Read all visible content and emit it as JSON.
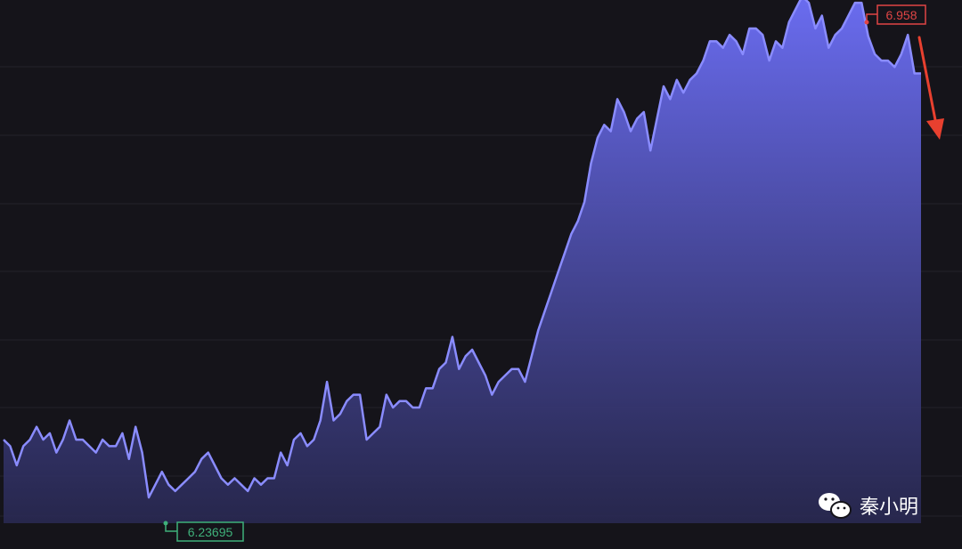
{
  "chart_data": {
    "type": "area",
    "title": "",
    "xlabel": "",
    "ylabel": "",
    "ylim": [
      6.2,
      6.97
    ],
    "grid": "horizontal",
    "legend": "none",
    "series": [
      {
        "values": [
          6.33,
          6.32,
          6.29,
          6.32,
          6.33,
          6.35,
          6.33,
          6.34,
          6.31,
          6.33,
          6.36,
          6.33,
          6.33,
          6.32,
          6.31,
          6.33,
          6.32,
          6.32,
          6.34,
          6.3,
          6.35,
          6.31,
          6.24,
          6.26,
          6.28,
          6.26,
          6.25,
          6.26,
          6.27,
          6.28,
          6.3,
          6.31,
          6.29,
          6.27,
          6.26,
          6.27,
          6.26,
          6.25,
          6.27,
          6.26,
          6.27,
          6.27,
          6.31,
          6.29,
          6.33,
          6.34,
          6.32,
          6.33,
          6.36,
          6.42,
          6.36,
          6.37,
          6.39,
          6.4,
          6.4,
          6.33,
          6.34,
          6.35,
          6.4,
          6.38,
          6.39,
          6.39,
          6.38,
          6.38,
          6.41,
          6.41,
          6.44,
          6.45,
          6.49,
          6.44,
          6.46,
          6.47,
          6.45,
          6.43,
          6.4,
          6.42,
          6.43,
          6.44,
          6.44,
          6.42,
          6.46,
          6.5,
          6.53,
          6.56,
          6.59,
          6.62,
          6.65,
          6.67,
          6.7,
          6.76,
          6.8,
          6.82,
          6.81,
          6.86,
          6.84,
          6.81,
          6.83,
          6.84,
          6.78,
          6.83,
          6.88,
          6.86,
          6.89,
          6.87,
          6.89,
          6.9,
          6.92,
          6.95,
          6.95,
          6.94,
          6.96,
          6.95,
          6.93,
          6.97,
          6.97,
          6.96,
          6.92,
          6.95,
          6.94,
          6.98,
          7.0,
          7.02,
          7.01,
          6.97,
          6.99,
          6.94,
          6.96,
          6.97,
          6.99,
          7.01,
          7.01,
          6.958,
          6.93,
          6.92,
          6.92,
          6.91,
          6.93,
          6.96,
          6.9,
          6.9
        ]
      }
    ],
    "annotations": {
      "high": {
        "label": "6.958",
        "color": "#e04545"
      },
      "low": {
        "label": "6.23695",
        "color": "#3fb07a"
      }
    },
    "colors": {
      "line": "#8a8cff",
      "area_top": "#6a6cf0",
      "area_bottom": "#2a2a55",
      "background": "#15141a",
      "grid": "#23222b",
      "arrow": "#e8402f"
    }
  },
  "watermark": {
    "icon": "wechat-icon",
    "text": "秦小明"
  }
}
